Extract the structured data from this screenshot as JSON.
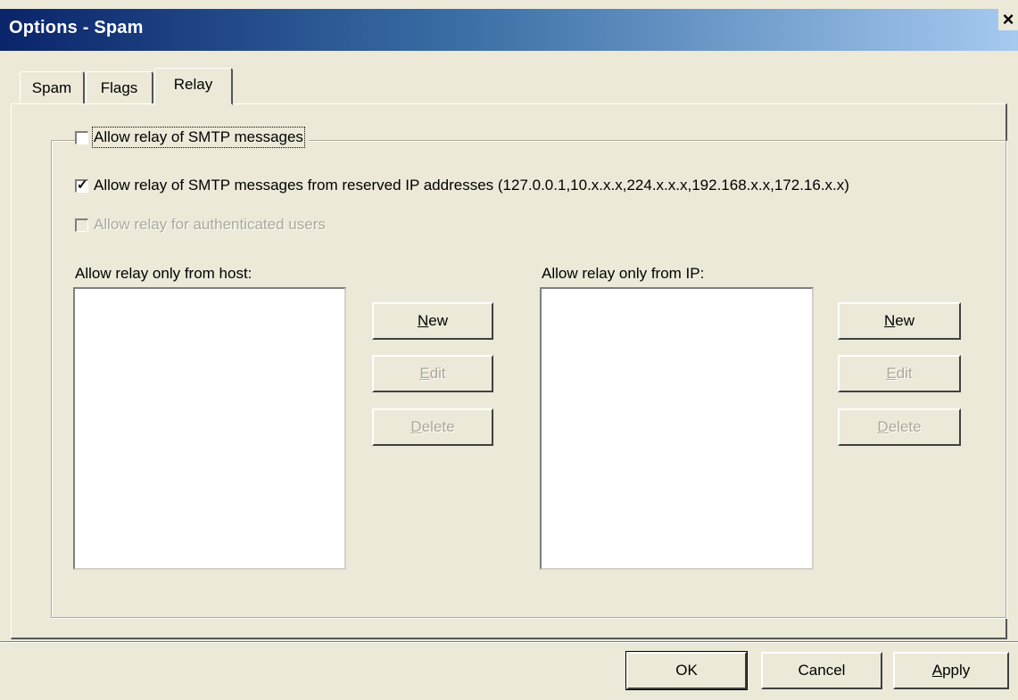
{
  "window": {
    "title": "Options - Spam",
    "close_label": "×"
  },
  "tabs": [
    {
      "label": "Spam"
    },
    {
      "label": "Flags"
    },
    {
      "label": "Relay",
      "active": true
    }
  ],
  "relay": {
    "allow_relay_smtp": {
      "label": "Allow relay of SMTP messages",
      "checked": false
    },
    "allow_reserved_ip": {
      "label": "Allow relay of SMTP messages from reserved IP addresses (127.0.0.1,10.x.x.x,224.x.x.x,192.168.x.x,172.16.x.x)",
      "checked": true
    },
    "allow_authenticated": {
      "label": "Allow relay for authenticated users",
      "checked": false,
      "disabled": true
    },
    "host_list": {
      "label": "Allow relay only from host:",
      "buttons": {
        "new": {
          "accel": "N",
          "rest": "ew"
        },
        "edit": {
          "accel": "E",
          "rest": "dit"
        },
        "delete": {
          "accel": "D",
          "rest": "elete"
        }
      }
    },
    "ip_list": {
      "label": "Allow relay only from IP:",
      "buttons": {
        "new": {
          "accel": "N",
          "rest": "ew"
        },
        "edit": {
          "accel": "E",
          "rest": "dit"
        },
        "delete": {
          "accel": "D",
          "rest": "elete"
        }
      }
    }
  },
  "footer": {
    "ok_label": "OK",
    "cancel_label": "Cancel",
    "apply": {
      "accel": "A",
      "rest": "pply"
    }
  }
}
